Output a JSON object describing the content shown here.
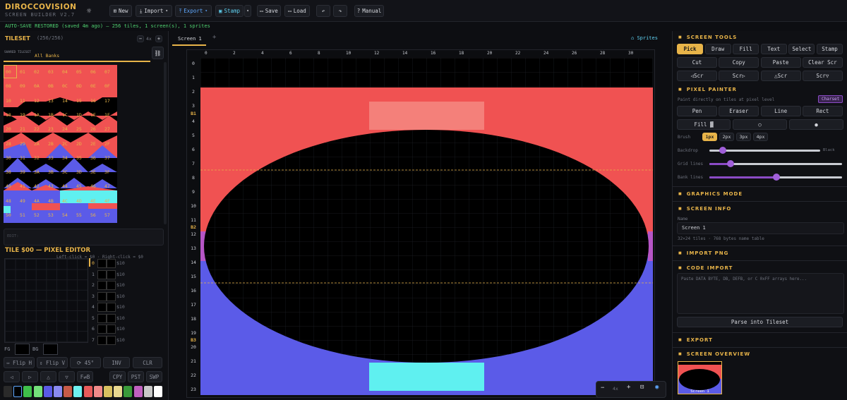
{
  "app": {
    "brand": "DIROCCOVISION",
    "subtitle": "SCREEN BUILDER V2.7"
  },
  "toolbar": {
    "new": "New",
    "import": "Import",
    "export": "Export",
    "stamp": "Stamp",
    "save": "Save",
    "load": "Load",
    "manual": "Manual"
  },
  "status": "AUTO-SAVE RESTORED (saved 4m ago) — 256 tiles, 1 screen(s), 1 sprites",
  "tileset": {
    "title": "TILESET",
    "count": "(256/256)",
    "zoom": "4x",
    "shared_label": "SHARED TILESET",
    "bank_value": "All Banks",
    "edit_placeholder": "EDIT:",
    "rows": [
      [
        "00",
        "01",
        "02",
        "03",
        "04",
        "05",
        "06",
        "07"
      ],
      [
        "08",
        "09",
        "0A",
        "0B",
        "0C",
        "0D",
        "0E",
        "0F"
      ],
      [
        "10",
        "11",
        "12",
        "13",
        "14",
        "15",
        "16",
        "17"
      ],
      [
        "18",
        "19",
        "1A",
        "1B",
        "1C",
        "1D",
        "1E",
        "1F"
      ],
      [
        "20",
        "21",
        "22",
        "23",
        "24",
        "25",
        "26",
        "27"
      ],
      [
        "28",
        "29",
        "2A",
        "2B",
        "2C",
        "2D",
        "2E",
        "2F"
      ],
      [
        "30",
        "31",
        "32",
        "33",
        "34",
        "35",
        "36",
        "37"
      ],
      [
        "38",
        "39",
        "3A",
        "3B",
        "3C",
        "3D",
        "3E",
        "3F"
      ],
      [
        "40",
        "41",
        "42",
        "43",
        "44",
        "45",
        "46",
        "47"
      ],
      [
        "48",
        "49",
        "4A",
        "4B",
        "4C",
        "4D",
        "4E",
        "4F"
      ],
      [
        "50",
        "51",
        "52",
        "53",
        "54",
        "55",
        "56",
        "57"
      ]
    ]
  },
  "pixel_editor": {
    "title": "TILE $00 — PIXEL EDITOR",
    "hint": "Left-click = $0 · Right-click = $0",
    "rows": [
      {
        "n": "0",
        "v": "$10"
      },
      {
        "n": "1",
        "v": "$10"
      },
      {
        "n": "2",
        "v": "$10"
      },
      {
        "n": "3",
        "v": "$10"
      },
      {
        "n": "4",
        "v": "$10"
      },
      {
        "n": "5",
        "v": "$10"
      },
      {
        "n": "6",
        "v": "$10"
      },
      {
        "n": "7",
        "v": "$10"
      }
    ],
    "fg": "FG",
    "bg": "BG",
    "flip_h": "⇔ Flip H",
    "flip_v": "⇕ Flip V",
    "rotate": "⟳ 45°",
    "inv": "INV",
    "clr": "CLR",
    "sh_l": "◁",
    "sh_r": "▷",
    "sh_u": "△",
    "sh_d": "▽",
    "fb": "F⇄B",
    "cpy": "CPY",
    "pst": "PST",
    "swp": "SWP",
    "palette": [
      "#2a2a2a",
      "#000000",
      "#3fbf4a",
      "#74e07a",
      "#5a5ae6",
      "#8a8af0",
      "#c65a48",
      "#6ef0f0",
      "#e85a5a",
      "#f08a8a",
      "#d8c060",
      "#e8d890",
      "#3a9a3a",
      "#c060c0",
      "#c8c8c8",
      "#ffffff"
    ]
  },
  "canvas": {
    "tab": "Screen 1",
    "add_tab": "+",
    "sprites": "Sprites",
    "col_labels": [
      "0",
      "2",
      "4",
      "6",
      "8",
      "10",
      "12",
      "14",
      "16",
      "18",
      "20",
      "22",
      "24",
      "26",
      "28",
      "30"
    ],
    "row_labels": [
      "0",
      "1",
      "2",
      "3",
      "B1",
      "4",
      "5",
      "6",
      "7",
      "8",
      "9",
      "10",
      "11",
      "B2",
      "12",
      "13",
      "14",
      "15",
      "16",
      "17",
      "18",
      "19",
      "B3",
      "20",
      "21",
      "22",
      "23"
    ],
    "zoom": {
      "minus": "−",
      "level": "4x",
      "plus": "+",
      "fit": "⊡",
      "eye": "◉"
    }
  },
  "screen_tools": {
    "title": "SCREEN TOOLS",
    "tools": [
      "Pick",
      "Draw",
      "Fill",
      "Text",
      "Select",
      "Stamp"
    ],
    "row2": [
      "Cut",
      "Copy",
      "Paste",
      "Clear Scr"
    ],
    "row3": [
      "◁Scr",
      "Scr▷",
      "△Scr",
      "Scr▽"
    ]
  },
  "pixel_painter": {
    "title": "PIXEL PAINTER",
    "desc": "Paint directly on tiles at pixel level",
    "badge": "Charset",
    "tools": [
      "Pen",
      "Eraser",
      "Line",
      "Rect"
    ],
    "fill": "Fill ▓",
    "circle": "○",
    "dot": "●",
    "brush_label": "Brush",
    "brush": [
      "1px",
      "2px",
      "3px",
      "4px"
    ],
    "backdrop": "Backdrop",
    "backdrop_value": "Black",
    "grid_lines": "Grid lines",
    "bank_lines": "Bank lines"
  },
  "graphics_mode": {
    "title": "GRAPHICS MODE"
  },
  "screen_info": {
    "title": "SCREEN INFO",
    "name_label": "Name",
    "name_value": "Screen 1",
    "meta": "32×24 tiles · 768 bytes name table"
  },
  "import_png": {
    "title": "IMPORT PNG"
  },
  "code_import": {
    "title": "CODE IMPORT",
    "placeholder": "Paste DATA BYTE, DB, DEFB, or C 0xFF arrays here...",
    "button": "Parse into Tileset"
  },
  "export_section": {
    "title": "EXPORT"
  },
  "overview": {
    "title": "SCREEN OVERVIEW",
    "label": "Screen 1"
  },
  "colors": {
    "accent": "#e8b449",
    "red": "#f05252",
    "blue": "#5b5be8",
    "cyan": "#5ff0f0",
    "salmon": "#f4807a",
    "purple": "#8b4bc6"
  }
}
